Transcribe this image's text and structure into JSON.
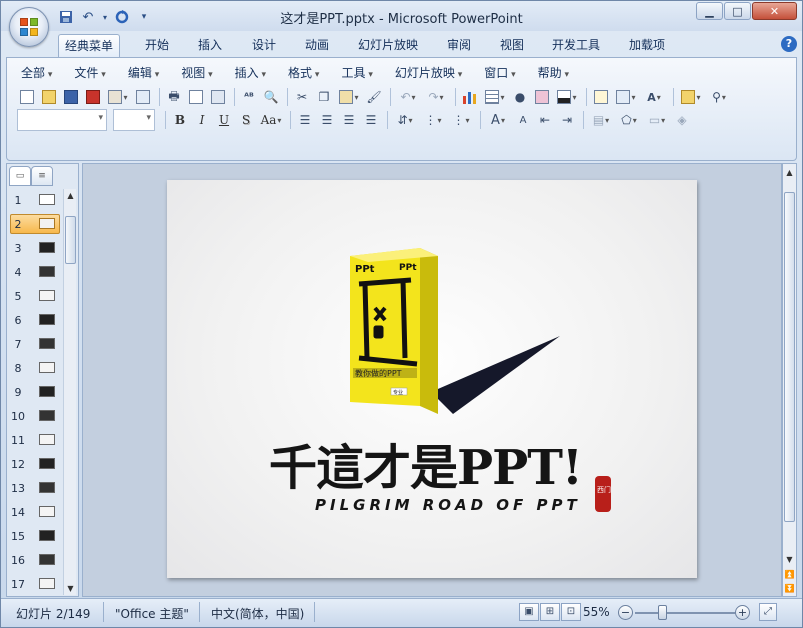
{
  "window": {
    "title": "这才是PPT.pptx - Microsoft PowerPoint",
    "controls": [
      "minimize-icon",
      "maximize-icon",
      "close-icon"
    ]
  },
  "quick_access": [
    "save-icon",
    "undo-icon",
    "redo-icon",
    "customize-icon"
  ],
  "ribbon_tabs": [
    {
      "label": "经典菜单",
      "active": true
    },
    {
      "label": "开始"
    },
    {
      "label": "插入"
    },
    {
      "label": "设计"
    },
    {
      "label": "动画"
    },
    {
      "label": "幻灯片放映"
    },
    {
      "label": "审阅"
    },
    {
      "label": "视图"
    },
    {
      "label": "开发工具"
    },
    {
      "label": "加载项"
    }
  ],
  "menu": [
    "全部",
    "文件",
    "编辑",
    "视图",
    "插入",
    "格式",
    "工具",
    "幻灯片放映",
    "窗口",
    "帮助"
  ],
  "format_buttons": {
    "bold": "B",
    "italic": "I",
    "underline": "U",
    "shadow": "S",
    "case": "Aa"
  },
  "slides": {
    "current": 2,
    "items": [
      "1",
      "2",
      "3",
      "4",
      "5",
      "6",
      "7",
      "8",
      "9",
      "10",
      "11",
      "12",
      "13",
      "14",
      "15",
      "16",
      "17"
    ]
  },
  "slide_content": {
    "box_top_left": "PPt",
    "box_top_right": "PPt",
    "box_band": "教你做的PPT",
    "box_bottom": "专业",
    "headline": "千這才是PPT!",
    "subtitle": "PILGRIM ROAD OF PPT",
    "seal": "西门",
    "box_color": "#f3e41c"
  },
  "status": {
    "slide_info": "幻灯片 2/149",
    "theme": "\"Office 主题\"",
    "language": "中文(简体，中国)",
    "zoom": "55%",
    "zoom_value": 55
  }
}
